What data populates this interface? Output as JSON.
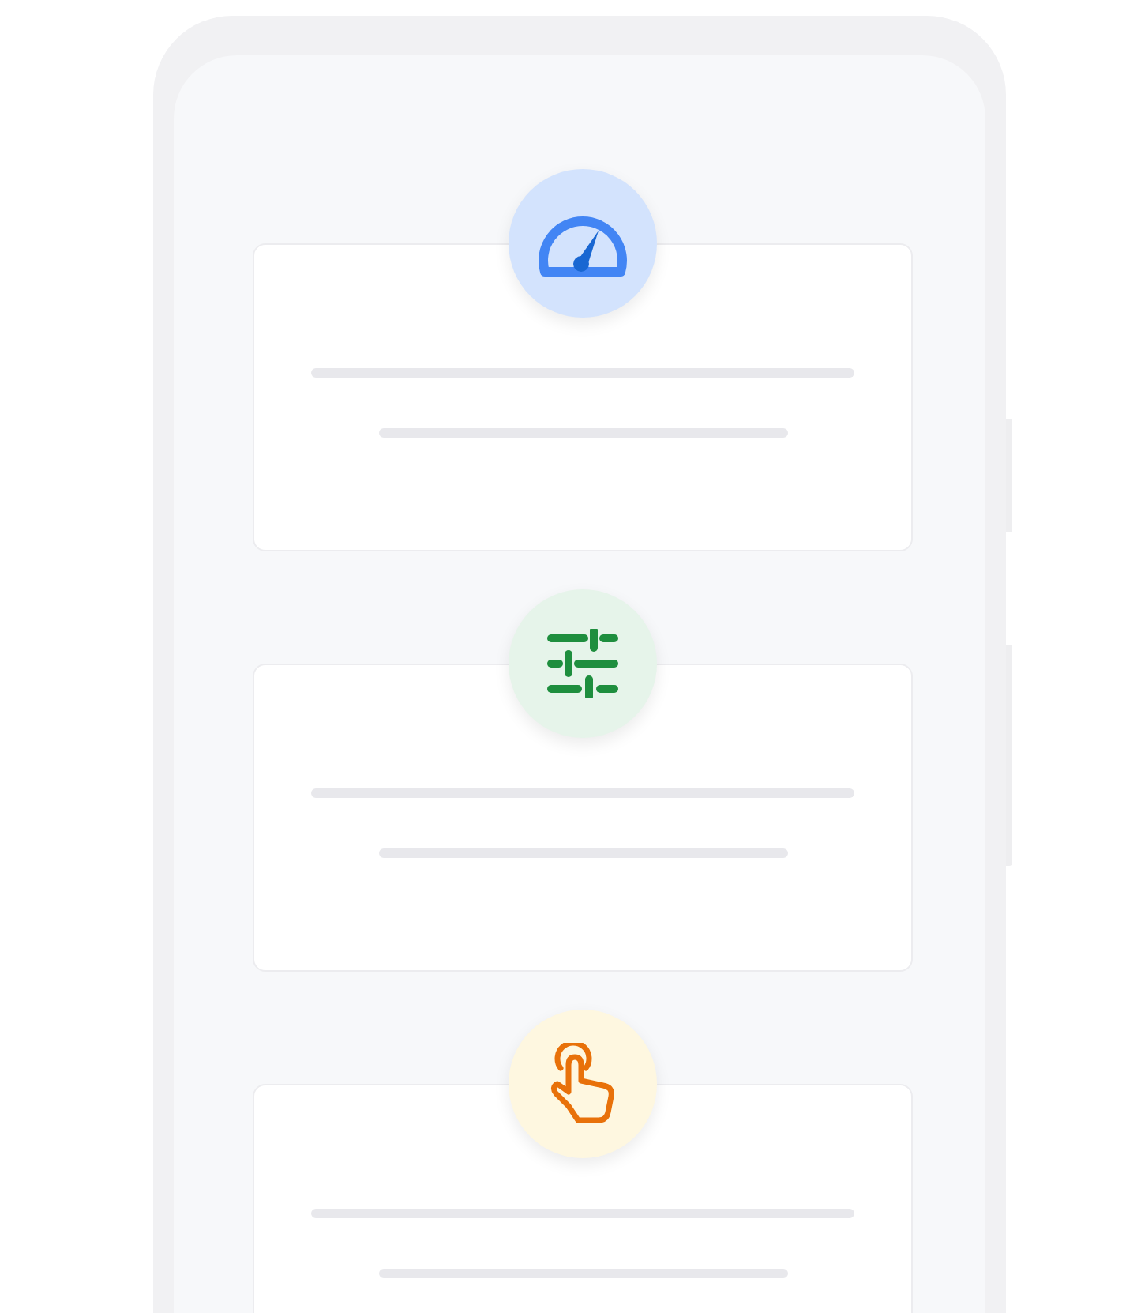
{
  "cards": [
    {
      "kind": "gauge",
      "color": "#d3e3fd"
    },
    {
      "kind": "sliders",
      "color": "#e6f4ea"
    },
    {
      "kind": "touch",
      "color": "#fef7e0"
    }
  ]
}
